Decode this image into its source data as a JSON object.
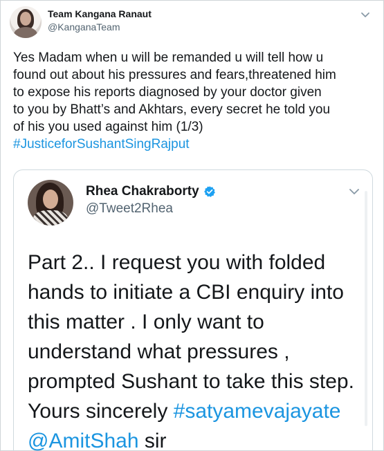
{
  "outer": {
    "name": "Team Kangana Ranaut",
    "handle": "@KanganaTeam",
    "text_lines": [
      "Yes Madam when u will be remanded u will tell how u",
      "found out about his pressures and fears,threatened him",
      "to expose his reports diagnosed by your doctor given",
      "to you by Bhatt’s and Akhtars, every secret he told you",
      "of his you used against him (1/3)"
    ],
    "hashtag": "#JusticeforSushantSingRajput",
    "menu_icon": "chevron-down-icon"
  },
  "quoted": {
    "name": "Rhea Chakraborty",
    "handle": "@Tweet2Rhea",
    "verified_icon": "verified-badge-icon",
    "menu_icon": "chevron-down-icon",
    "text_lines": [
      "Part 2.. I request you with folded",
      "hands to initiate a CBI enquiry into",
      "this matter . I only want to",
      "understand what pressures  ,",
      "prompted Sushant to take this step."
    ],
    "line6_prefix": "Yours sincerely ",
    "line6_hashtag": "#satyamevajayate",
    "mention": "@AmitShah",
    "line7_suffix": " sir"
  },
  "colors": {
    "link": "#1b95e0",
    "verified": "#1da1f2",
    "text": "#14171a",
    "muted": "#536471"
  }
}
